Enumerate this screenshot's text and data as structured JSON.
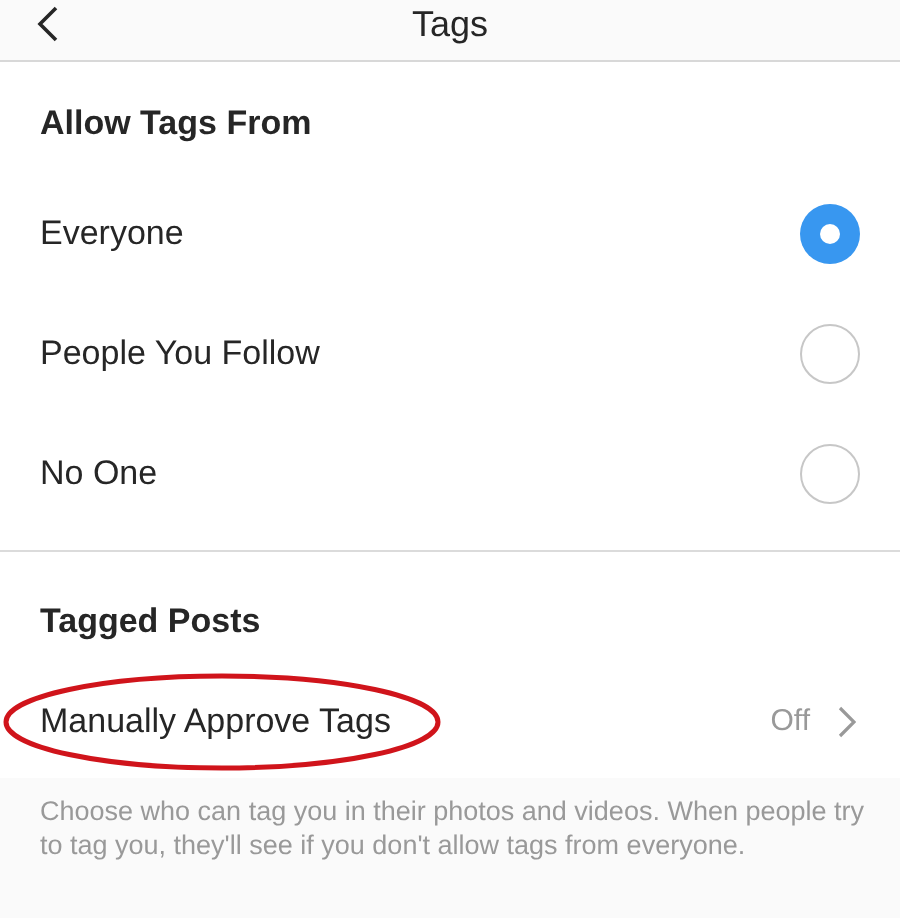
{
  "header": {
    "title": "Tags"
  },
  "allow_tags": {
    "title": "Allow Tags From",
    "options": [
      {
        "label": "Everyone",
        "selected": true
      },
      {
        "label": "People You Follow",
        "selected": false
      },
      {
        "label": "No One",
        "selected": false
      }
    ]
  },
  "tagged_posts": {
    "title": "Tagged Posts",
    "items": [
      {
        "label": "Manually Approve Tags",
        "value": "Off",
        "circled": true
      }
    ],
    "note": "Choose who can tag you in their photos and videos. When people try to tag you, they'll see if you don't allow tags from everyone."
  }
}
